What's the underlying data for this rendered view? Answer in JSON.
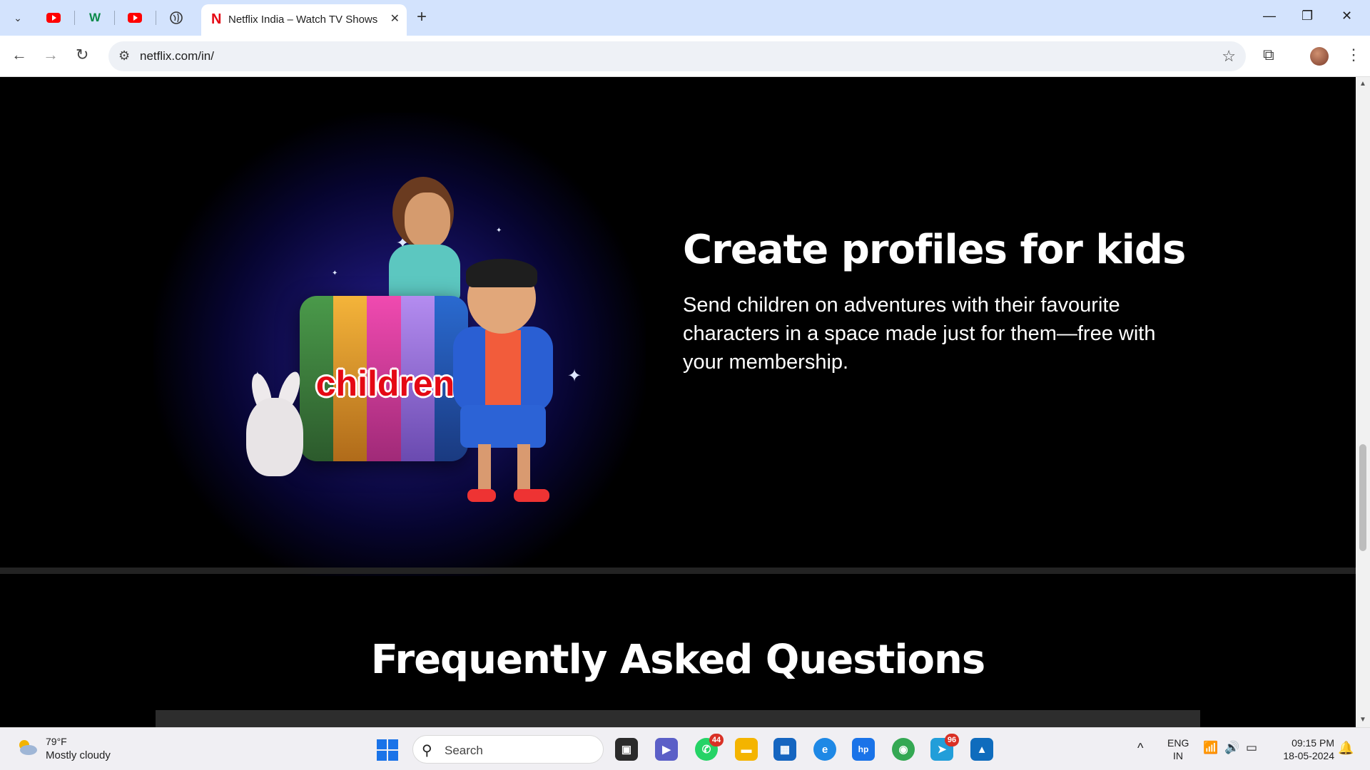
{
  "browser": {
    "tabs": [
      {
        "type": "tab-list-button",
        "icon": "chevron-down-icon"
      },
      {
        "type": "pinned",
        "icon": "youtube-icon"
      },
      {
        "type": "pinned",
        "icon": "w-icon",
        "glyph": "W"
      },
      {
        "type": "pinned",
        "icon": "youtube-icon"
      },
      {
        "type": "pinned",
        "icon": "globe-icon"
      }
    ],
    "active_tab": {
      "glyph": "N",
      "title": "Netflix India – Watch TV Shows",
      "close": "✕"
    },
    "new_tab": "+",
    "window_controls": {
      "minimize": "—",
      "restore": "❐",
      "close": "✕"
    },
    "url": "netflix.com/in/",
    "nav": {
      "back": "←",
      "forward": "→",
      "reload": "↻",
      "site_info": "⚙",
      "bookmark": "☆",
      "extensions": "⧉",
      "menu": "⋮"
    }
  },
  "page": {
    "kids": {
      "art_word": "children",
      "title": "Create profiles for kids",
      "description": "Send children on adventures with their favourite characters in a space made just for them—free with your membership."
    },
    "faq": {
      "title": "Frequently Asked Questions"
    }
  },
  "taskbar": {
    "weather": {
      "temp": "79°F",
      "desc": "Mostly cloudy"
    },
    "search": {
      "placeholder": "Search",
      "icon": "search-icon"
    },
    "apps": [
      {
        "name": "task-view",
        "glyph": "▣",
        "bg": "#2b2b2b"
      },
      {
        "name": "teams-chat",
        "glyph": "▶",
        "bg": "#5b5fc7"
      },
      {
        "name": "whatsapp",
        "glyph": "✆",
        "bg": "#25d366",
        "badge": "44"
      },
      {
        "name": "file-explorer",
        "glyph": "▬",
        "bg": "#f4b400"
      },
      {
        "name": "microsoft-store",
        "glyph": "▦",
        "bg": "#1565c0"
      },
      {
        "name": "edge-app",
        "glyph": "e",
        "bg": "#1e88e5"
      },
      {
        "name": "myhp",
        "glyph": "hp",
        "bg": "#1a73e8"
      },
      {
        "name": "chrome",
        "glyph": "◉",
        "bg": "#34a853"
      },
      {
        "name": "telegram",
        "glyph": "➤",
        "bg": "#229ed9",
        "badge": "96"
      },
      {
        "name": "photos",
        "glyph": "▲",
        "bg": "#0f6cbd"
      }
    ],
    "tray": {
      "chevron": "^",
      "lang": "ENG",
      "region": "IN",
      "wifi": "📶",
      "volume": "🔊",
      "battery": "▭"
    },
    "clock": {
      "time": "09:15 PM",
      "date": "18-05-2024"
    }
  },
  "colors": {
    "netflix_red": "#e50914",
    "tab_bar": "#d3e3fd",
    "page_bg": "#000000"
  }
}
